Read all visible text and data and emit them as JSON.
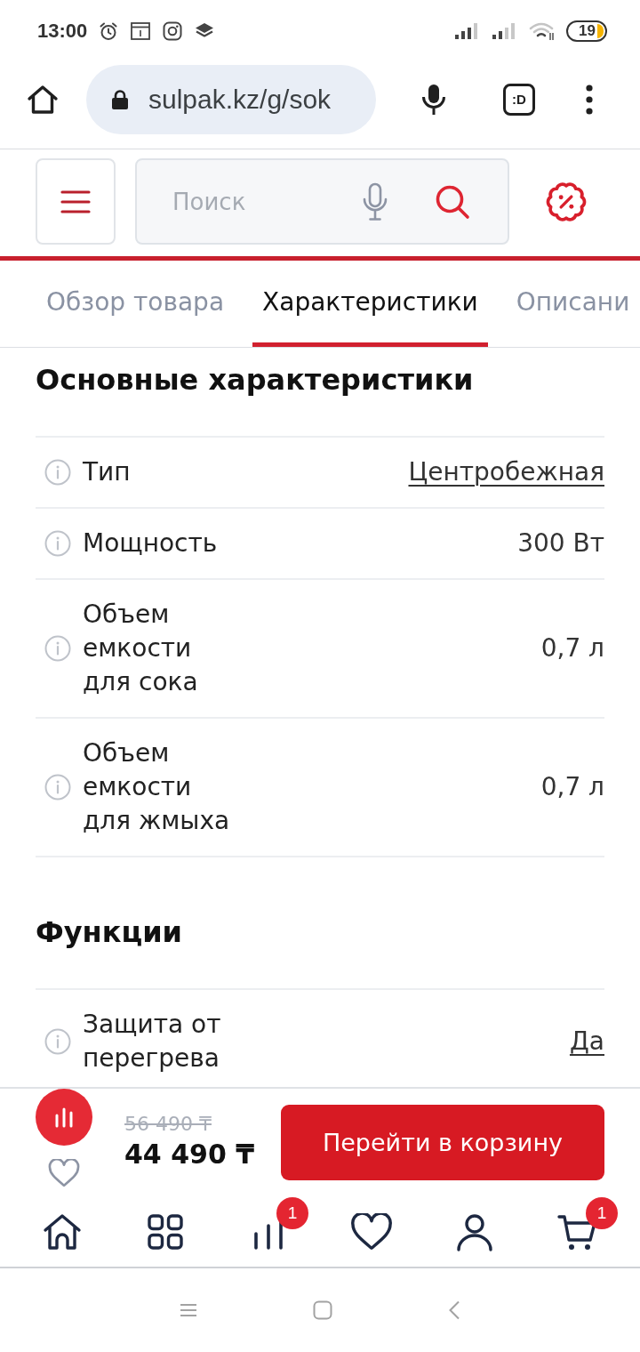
{
  "status_bar": {
    "time": "13:00",
    "battery": "19"
  },
  "browser": {
    "url": "sulpak.kz/g/sok",
    "tab_switcher": ":D"
  },
  "header": {
    "search": {
      "placeholder": "Поиск"
    }
  },
  "tabs": [
    {
      "label": "Обзор товара",
      "selected": false
    },
    {
      "label": "Характеристики",
      "selected": true
    },
    {
      "label": "Описани",
      "selected": false
    }
  ],
  "sections": [
    {
      "title": "Основные характеристики",
      "rows": [
        {
          "label": "Тип",
          "value": "Центробежная",
          "kind": "link"
        },
        {
          "label": "Мощность",
          "value": "300 Вт",
          "kind": "text"
        },
        {
          "label": "Объем емкости для сока",
          "value": "0,7 л",
          "kind": "text"
        },
        {
          "label": "Объем емкости для жмыха",
          "value": "0,7 л",
          "kind": "text"
        }
      ]
    },
    {
      "title": "Функции",
      "rows": [
        {
          "label": "Защита от перегрева",
          "value": "Да",
          "kind": "link"
        }
      ]
    }
  ],
  "purchase_bar": {
    "old_price": "56 490 ₸",
    "price": "44 490 ₸",
    "cart_button": "Перейти в корзину"
  },
  "bottom_nav": [
    {
      "kind": "home"
    },
    {
      "kind": "catalog"
    },
    {
      "kind": "compare",
      "badge": "1"
    },
    {
      "kind": "favorites"
    },
    {
      "kind": "profile"
    },
    {
      "kind": "cart",
      "badge": "1"
    }
  ]
}
